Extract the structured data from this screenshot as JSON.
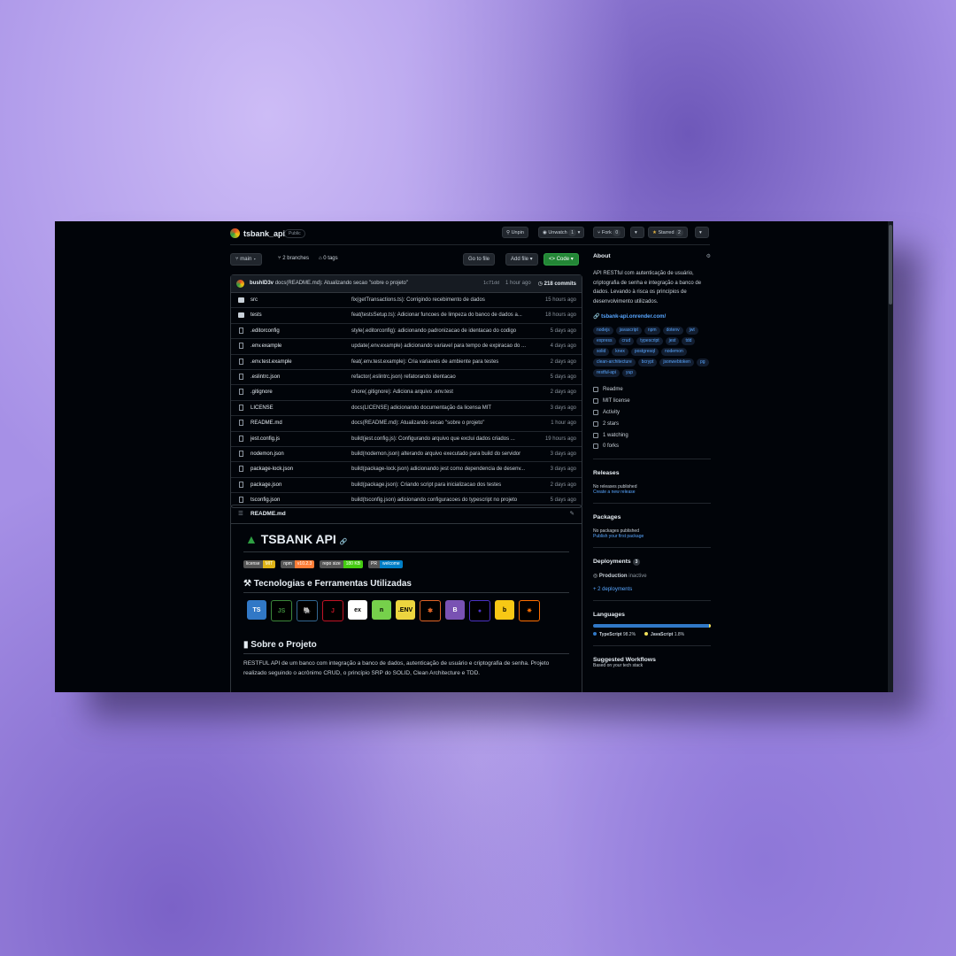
{
  "repo": {
    "name": "tsbank_api",
    "visibility": "Public"
  },
  "header_buttons": {
    "unpin": "Unpin",
    "unwatch": "Unwatch",
    "watch_count": "1",
    "fork": "Fork",
    "fork_count": "0",
    "starred": "Starred",
    "star_count": "2"
  },
  "branchbar": {
    "branch": "main",
    "branches": "2 branches",
    "tags": "0 tags",
    "goto": "Go to file",
    "addfile": "Add file",
    "code": "Code"
  },
  "commit": {
    "author": "bushID3v",
    "message": "docs(README.md): Atualizando secao \"sobre o projeto\"",
    "hash": "1c71dd",
    "time": "1 hour ago",
    "count": "218 commits"
  },
  "files": [
    {
      "name": "src",
      "type": "dir",
      "msg": "fix(getTransactions.ts): Corrigindo recebimento de dados",
      "time": "15 hours ago"
    },
    {
      "name": "tests",
      "type": "dir",
      "msg": "feat(testsSetup.ts): Adicionar funcoes de limpeza do banco de dados a...",
      "time": "18 hours ago"
    },
    {
      "name": ".editorconfig",
      "type": "file",
      "msg": "style(.editorconfig): adicionando padronizacao de identacao do codigo",
      "time": "5 days ago"
    },
    {
      "name": ".env.example",
      "type": "file",
      "msg": "update(.env.example) adicionando variavel para tempo de expiracao do ...",
      "time": "4 days ago"
    },
    {
      "name": ".env.test.example",
      "type": "file",
      "msg": "feat(.env.test.example): Cria variaveis de ambiente para testes",
      "time": "2 days ago"
    },
    {
      "name": ".eslintrc.json",
      "type": "file",
      "msg": "refactor(.eslintrc.json) refatorando identacao",
      "time": "5 days ago"
    },
    {
      "name": ".gitignore",
      "type": "file",
      "msg": "chore(.gitignore): Adiciona arquivo .env.test",
      "time": "2 days ago"
    },
    {
      "name": "LICENSE",
      "type": "file",
      "msg": "docs(LICENSE) adicionando documentação da licensa MIT",
      "time": "3 days ago"
    },
    {
      "name": "README.md",
      "type": "file",
      "msg": "docs(README.md): Atualizando secao \"sobre o projeto\"",
      "time": "1 hour ago"
    },
    {
      "name": "jest.config.js",
      "type": "file",
      "msg": "build(jest.config.js): Configurando arquivo que exclui dados criados ...",
      "time": "19 hours ago"
    },
    {
      "name": "nodemon.json",
      "type": "file",
      "msg": "build(nodemon.json) alterando arquivo executado para build do servidor",
      "time": "3 days ago"
    },
    {
      "name": "package-lock.json",
      "type": "file",
      "msg": "build(package-lock.json) adicionando jest como dependencia de desenv...",
      "time": "3 days ago"
    },
    {
      "name": "package.json",
      "type": "file",
      "msg": "build(package.json): Criando script para inicializacao dos testes",
      "time": "2 days ago"
    },
    {
      "name": "tsconfig.json",
      "type": "file",
      "msg": "build(tsconfig.json) adicionando configuracoes do typescript no projeto",
      "time": "5 days ago"
    }
  ],
  "readme": {
    "file": "README.md",
    "title": "TSBANK API",
    "badges": [
      {
        "label": "license",
        "value": "MIT",
        "color": "#dfb317"
      },
      {
        "label": "npm",
        "value": "v10.2.3",
        "color": "#fe7d37"
      },
      {
        "label": "repo size",
        "value": "180 KB",
        "color": "#4c1"
      },
      {
        "label": "PR",
        "value": "welcome",
        "color": "#007ec6"
      }
    ],
    "tech_heading": "Tecnologias e Ferramentas Utilizadas",
    "techs": [
      {
        "icon": "typescript-icon",
        "label": "TS",
        "bg": "#3178c6",
        "fg": "#fff"
      },
      {
        "icon": "nodejs-icon",
        "label": "JS",
        "bg": "#000",
        "fg": "#3c873a"
      },
      {
        "icon": "postgresql-icon",
        "label": "🐘",
        "bg": "#000",
        "fg": "#336791"
      },
      {
        "icon": "jest-icon",
        "label": "J",
        "bg": "#000",
        "fg": "#c21325"
      },
      {
        "icon": "express-icon",
        "label": "ex",
        "bg": "#fff",
        "fg": "#000"
      },
      {
        "icon": "nodemon-icon",
        "label": "n",
        "bg": "#76d04b",
        "fg": "#000"
      },
      {
        "icon": "dotenv-icon",
        "label": ".ENV",
        "bg": "#ecd53f",
        "fg": "#000"
      },
      {
        "icon": "knex-icon",
        "label": "✱",
        "bg": "#000",
        "fg": "#e16426"
      },
      {
        "icon": "bootstrap-icon",
        "label": "B",
        "bg": "#7952b3",
        "fg": "#fff"
      },
      {
        "icon": "eslint-icon",
        "label": "●",
        "bg": "#000",
        "fg": "#4b32c3"
      },
      {
        "icon": "bcrypt-icon",
        "label": "b",
        "bg": "#f7c815",
        "fg": "#000"
      },
      {
        "icon": "gear-icon",
        "label": "✷",
        "bg": "#000",
        "fg": "#ff6f00"
      }
    ],
    "about_heading": "Sobre o Projeto",
    "about_text": "RESTFUL API de um banco com integração a banco de dados, autenticação de usuário e criptografia de senha. Projeto realizado seguindo o acrônimo CRUD, o princípio SRP do SOLID, Clean Architecture e TDD."
  },
  "about": {
    "heading": "About",
    "description": "API RESTful com autenticação de usuário, criptografia de senha e integração a banco de dados. Levando à risca os princípios de desenvolvimento utilizados.",
    "website": "tsbank-api.onrender.com/",
    "topics": [
      "nodejs",
      "javascript",
      "npm",
      "dotenv",
      "jwt",
      "express",
      "crud",
      "typescript",
      "jest",
      "tdd",
      "solid",
      "knex",
      "postgresql",
      "nodemon",
      "clean-architecture",
      "bcrypt",
      "jsonwebtoken",
      "pg",
      "restful-api",
      "yup"
    ],
    "links": [
      {
        "icon": "book-icon",
        "label": "Readme"
      },
      {
        "icon": "scale-icon",
        "label": "MIT license"
      },
      {
        "icon": "pulse-icon",
        "label": "Activity"
      },
      {
        "icon": "star-icon",
        "label": "2 stars"
      },
      {
        "icon": "eye-icon",
        "label": "1 watching"
      },
      {
        "icon": "fork-icon",
        "label": "0 forks"
      }
    ]
  },
  "releases": {
    "heading": "Releases",
    "none": "No releases published",
    "create": "Create a new release"
  },
  "packages": {
    "heading": "Packages",
    "none": "No packages published",
    "publish": "Publish your first package"
  },
  "deployments": {
    "heading": "Deployments",
    "count": "3",
    "env": "Production",
    "status": "inactive",
    "more": "+ 2 deployments"
  },
  "languages": {
    "heading": "Languages",
    "items": [
      {
        "name": "TypeScript",
        "percent": "98.2%",
        "value": 98.2,
        "color": "#3178c6"
      },
      {
        "name": "JavaScript",
        "percent": "1.8%",
        "value": 1.8,
        "color": "#f1e05a"
      }
    ]
  },
  "workflows": {
    "heading": "Suggested Workflows",
    "sub": "Based on your tech stack"
  }
}
